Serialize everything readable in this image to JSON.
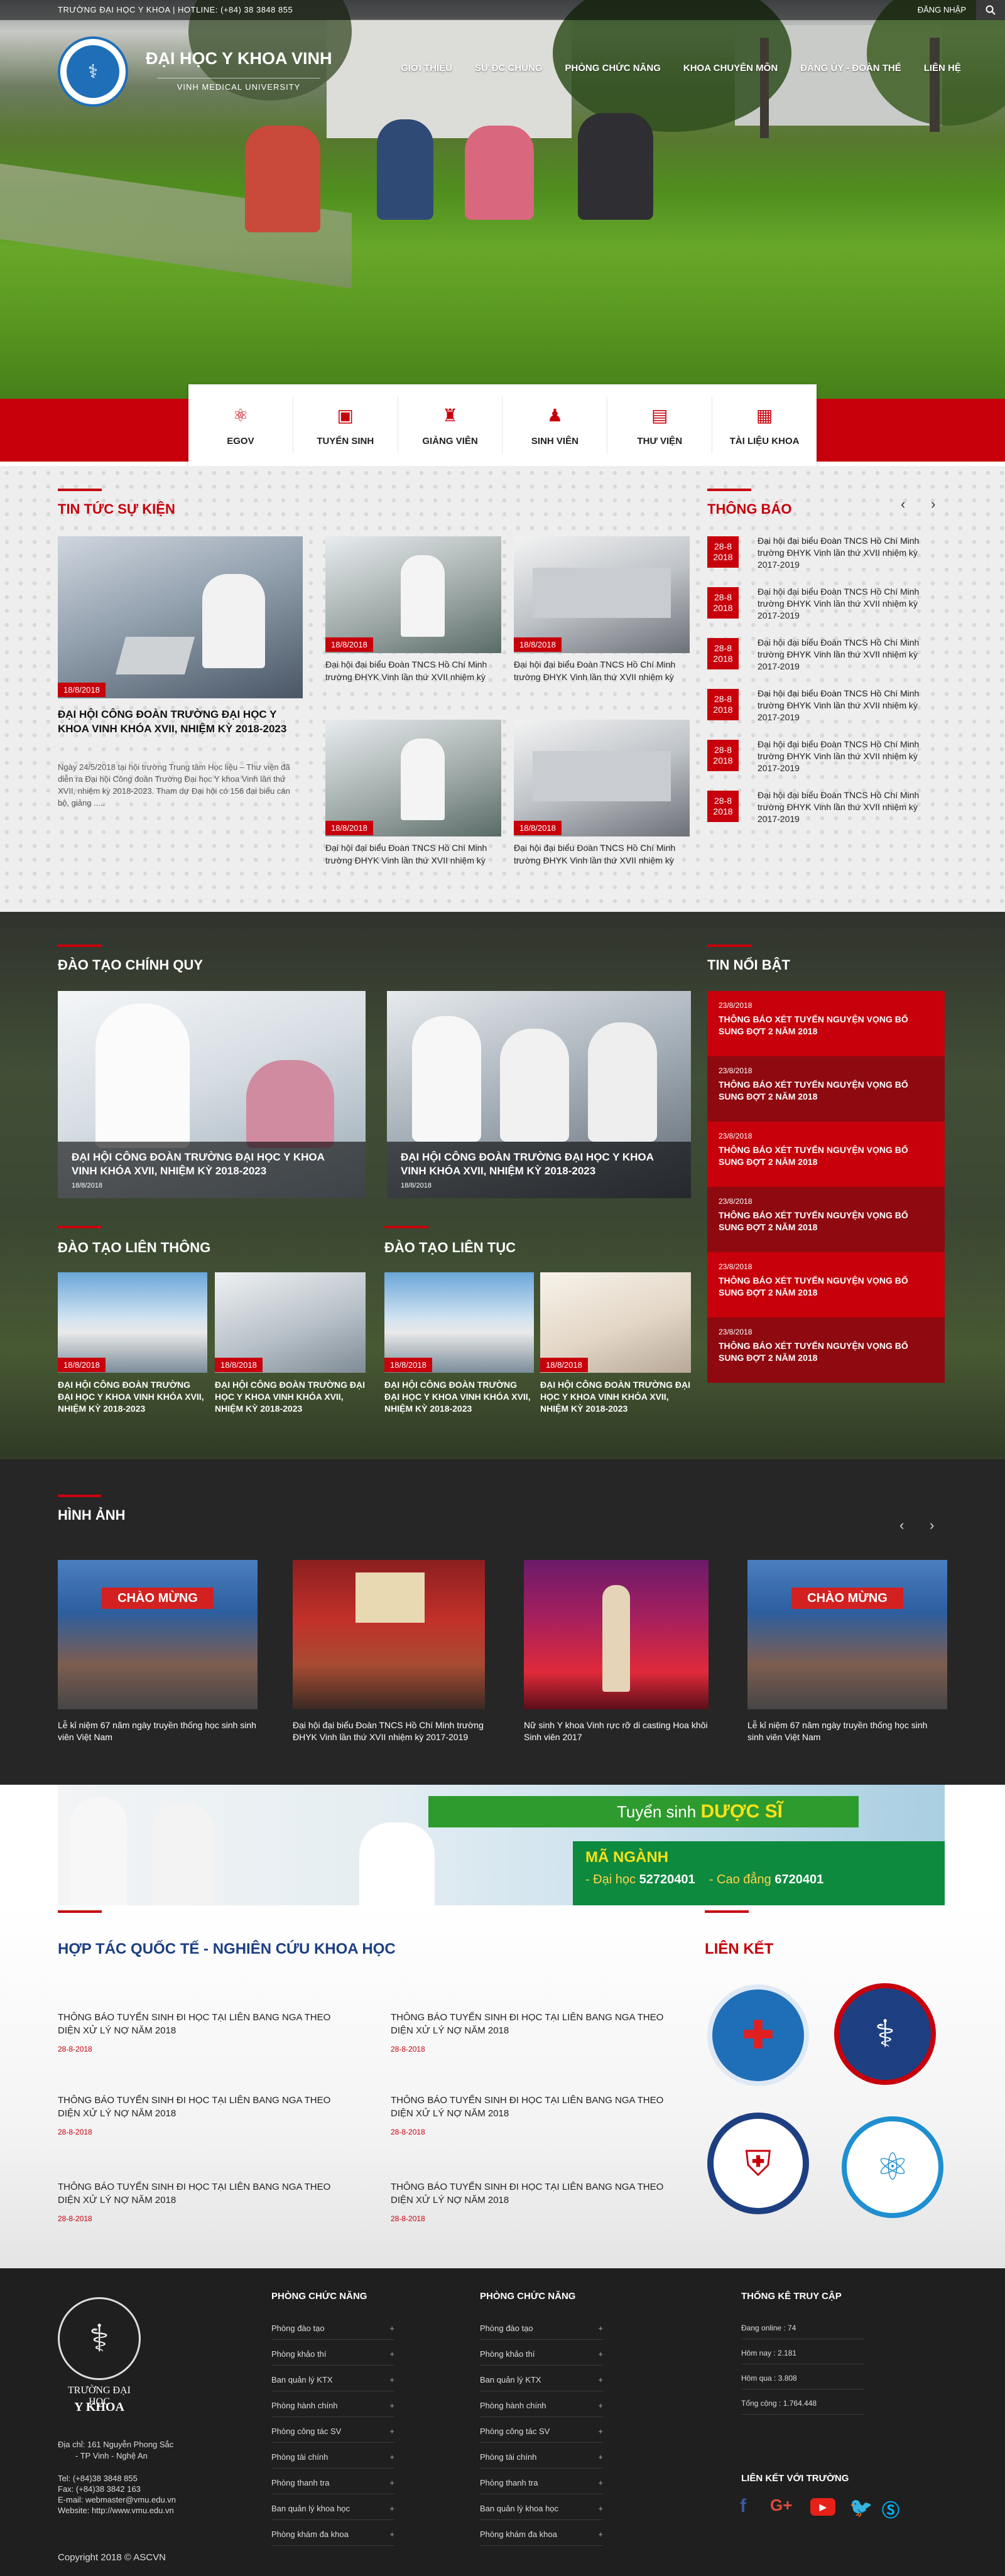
{
  "topbar": {
    "left_text": "TRƯỜNG ĐẠI HỌC Y KHOA  |  HOTLINE: (+84) 38 3848 855",
    "login": "ĐĂNG NHẬP"
  },
  "header": {
    "site_name": "ĐẠI HỌC Y KHOA VINH",
    "site_sub": "VINH MEDICAL UNIVERSITY"
  },
  "nav": [
    "GIỚI THIỆU",
    "SỰ ĐC CHUNG",
    "PHÒNG CHỨC NĂNG",
    "KHOA CHUYÊN MÔN",
    "ĐẢNG ỦY - ĐOÀN THỂ",
    "LIÊN HỆ"
  ],
  "quick_links": [
    {
      "label": "EGOV",
      "icon": "atom-icon"
    },
    {
      "label": "TUYỂN SINH",
      "icon": "enroll-icon"
    },
    {
      "label": "GIẢNG VIÊN",
      "icon": "teacher-icon"
    },
    {
      "label": "SINH VIÊN",
      "icon": "student-icon"
    },
    {
      "label": "THƯ VIỆN",
      "icon": "book-icon"
    },
    {
      "label": "TÀI LIỆU KHOA",
      "icon": "document-icon"
    }
  ],
  "news": {
    "title": "TIN TỨC SỰ KIỆN",
    "featured": {
      "date": "18/8/2018",
      "title": "ĐẠI HỘI CÔNG ĐOÀN TRƯỜNG ĐẠI HỌC Y KHOA VINH KHÓA XVII, NHIỆM KỲ 2018-2023",
      "excerpt": "Ngày 24/5/2018 tại hội trường Trung tâm Học liệu – Thư viện đã diễn ra Đại hội Công đoàn Trường Đại học Y khoa Vinh lần thứ XVII, nhiệm kỳ 2018-2023. Tham dự Đại hội có 156 đại biểu cán bộ, giảng ....."
    },
    "items": [
      {
        "date": "18/8/2018",
        "title": "Đại hội đại biểu Đoàn TNCS Hồ Chí Minh trường ĐHYK Vinh lần thứ XVII nhiệm kỳ"
      },
      {
        "date": "18/8/2018",
        "title": "Đại hội đại biểu Đoàn TNCS Hồ Chí Minh trường ĐHYK Vinh lần thứ XVII nhiệm kỳ"
      },
      {
        "date": "18/8/2018",
        "title": "Đại hội đại biểu Đoàn TNCS Hồ Chí Minh trường ĐHYK Vinh lần thứ XVII nhiệm kỳ"
      },
      {
        "date": "18/8/2018",
        "title": "Đại hội đại biểu Đoàn TNCS Hồ Chí Minh trường ĐHYK Vinh lần thứ XVII nhiệm kỳ"
      }
    ]
  },
  "announcements": {
    "title": "THÔNG BÁO",
    "items": [
      {
        "day": "28-8",
        "year": "2018",
        "text": "Đại hội đại biểu Đoàn TNCS Hồ Chí Minh trường ĐHYK Vinh lần thứ XVII nhiệm kỳ 2017-2019"
      },
      {
        "day": "28-8",
        "year": "2018",
        "text": "Đại hội đại biểu Đoàn TNCS Hồ Chí Minh trường ĐHYK Vinh lần thứ XVII nhiệm kỳ 2017-2019"
      },
      {
        "day": "28-8",
        "year": "2018",
        "text": "Đại hội đại biểu Đoàn TNCS Hồ Chí Minh trường ĐHYK Vinh lần thứ XVII nhiệm kỳ 2017-2019"
      },
      {
        "day": "28-8",
        "year": "2018",
        "text": "Đại hội đại biểu Đoàn TNCS Hồ Chí Minh trường ĐHYK Vinh lần thứ XVII nhiệm kỳ 2017-2019"
      },
      {
        "day": "28-8",
        "year": "2018",
        "text": "Đại hội đại biểu Đoàn TNCS Hồ Chí Minh trường ĐHYK Vinh lần thứ XVII nhiệm kỳ 2017-2019"
      },
      {
        "day": "28-8",
        "year": "2018",
        "text": "Đại hội đại biểu Đoàn TNCS Hồ Chí Minh trường ĐHYK Vinh lần thứ XVII nhiệm kỳ 2017-2019"
      }
    ]
  },
  "regular": {
    "title": "ĐÀO TẠO CHÍNH QUY",
    "items": [
      {
        "title": "ĐẠI HỘI CÔNG ĐOÀN TRƯỜNG ĐẠI HỌC Y KHOA VINH KHÓA XVII, NHIỆM KỲ 2018-2023",
        "date": "18/8/2018"
      },
      {
        "title": "ĐẠI HỘI CÔNG ĐOÀN TRƯỜNG ĐẠI HỌC Y KHOA VINH KHÓA XVII, NHIỆM KỲ 2018-2023",
        "date": "18/8/2018"
      }
    ]
  },
  "highlights": {
    "title": "TIN NỔI BẬT",
    "items": [
      {
        "date": "23/8/2018",
        "title": "THÔNG BÁO XÉT TUYỂN NGUYỆN VỌNG BỔ SUNG  ĐỢT 2 NĂM 2018"
      },
      {
        "date": "23/8/2018",
        "title": "THÔNG BÁO XÉT TUYỂN NGUYỆN VỌNG BỔ SUNG  ĐỢT 2 NĂM 2018"
      },
      {
        "date": "23/8/2018",
        "title": "THÔNG BÁO XÉT TUYỂN NGUYỆN VỌNG BỔ SUNG  ĐỢT 2 NĂM 2018"
      },
      {
        "date": "23/8/2018",
        "title": "THÔNG BÁO XÉT TUYỂN NGUYỆN VỌNG BỔ SUNG  ĐỢT 2 NĂM 2018"
      },
      {
        "date": "23/8/2018",
        "title": "THÔNG BÁO XÉT TUYỂN NGUYỆN VỌNG BỔ SUNG  ĐỢT 2 NĂM 2018"
      },
      {
        "date": "23/8/2018",
        "title": "THÔNG BÁO XÉT TUYỂN NGUYỆN VỌNG BỔ SUNG  ĐỢT 2 NĂM 2018"
      }
    ]
  },
  "transfer": {
    "title": "ĐÀO TẠO LIÊN THÔNG",
    "items": [
      {
        "date": "18/8/2018",
        "title": "ĐẠI HỘI CÔNG ĐOÀN TRƯỜNG ĐẠI HỌC Y KHOA VINH KHÓA XVII, NHIỆM KỲ 2018-2023"
      },
      {
        "date": "18/8/2018",
        "title": "ĐẠI HỘI CÔNG ĐOÀN TRƯỜNG ĐẠI HỌC Y KHOA VINH KHÓA XVII, NHIỆM KỲ 2018-2023"
      }
    ]
  },
  "continuing": {
    "title": "ĐÀO TẠO LIÊN TỤC",
    "items": [
      {
        "date": "18/8/2018",
        "title": "ĐẠI HỘI CÔNG ĐOÀN TRƯỜNG ĐẠI HỌC Y KHOA VINH KHÓA XVII, NHIỆM KỲ 2018-2023"
      },
      {
        "date": "18/8/2018",
        "title": "ĐẠI HỘI CÔNG ĐOÀN TRƯỜNG ĐẠI HỌC Y KHOA VINH KHÓA XVII, NHIỆM KỲ 2018-2023"
      }
    ]
  },
  "gallery": {
    "title": "HÌNH ẢNH",
    "items": [
      {
        "caption": "Lễ kỉ niệm 67 năm ngày truyền thống học sinh sinh viên Việt Nam",
        "banner": "CHÀO MỪNG"
      },
      {
        "caption": "Đại hội đại biểu Đoàn TNCS Hồ Chí Minh trường ĐHYK Vinh lần thứ XVII nhiệm kỳ 2017-2019"
      },
      {
        "caption": "Nữ sinh Y khoa Vinh rực rỡ di casting Hoa khôi Sinh viên 2017"
      },
      {
        "caption": "Lễ kỉ niệm 67 năm ngày truyền thống học sinh sinh viên Việt Nam",
        "banner": "CHÀO MỪNG"
      }
    ]
  },
  "banner": {
    "headline": "Tuyển sinh",
    "headline_em": "DƯỢC SĨ",
    "major_title": "MÃ NGÀNH",
    "uni_label": "- Đại học",
    "uni_code": "52720401",
    "col_label": "- Cao đẳng",
    "col_code": "6720401"
  },
  "cooperation": {
    "title": "HỢP TÁC QUỐC TẾ - NGHIÊN CỨU KHOA HỌC",
    "items": [
      {
        "title": "THÔNG BÁO TUYỂN SINH ĐI HỌC TẠI LIÊN BANG NGA THEO DIỆN XỬ LÝ NỢ NĂM 2018",
        "date": "28-8-2018"
      },
      {
        "title": "THÔNG BÁO TUYỂN SINH ĐI HỌC TẠI LIÊN BANG NGA THEO DIỆN XỬ LÝ NỢ NĂM 2018",
        "date": "28-8-2018"
      },
      {
        "title": "THÔNG BÁO TUYỂN SINH ĐI HỌC TẠI LIÊN BANG NGA THEO DIỆN XỬ LÝ NỢ NĂM 2018",
        "date": "28-8-2018"
      },
      {
        "title": "THÔNG BÁO TUYỂN SINH ĐI HỌC TẠI LIÊN BANG NGA THEO DIỆN XỬ LÝ NỢ NĂM 2018",
        "date": "28-8-2018"
      },
      {
        "title": "THÔNG BÁO TUYỂN SINH ĐI HỌC TẠI LIÊN BANG NGA THEO DIỆN XỬ LÝ NỢ NĂM 2018",
        "date": "28-8-2018"
      },
      {
        "title": "THÔNG BÁO TUYỂN SINH ĐI HỌC TẠI LIÊN BANG NGA THEO DIỆN XỬ LÝ NỢ NĂM 2018",
        "date": "28-8-2018"
      }
    ]
  },
  "links": {
    "title": "LIÊN KẾT"
  },
  "footer": {
    "school_line1": "TRƯỜNG ĐẠI HỌC",
    "school_line2": "Y KHOA",
    "address1": "Địa chỉ: 161 Nguyễn Phong Sắc",
    "address2": "- TP Vinh - Nghệ An",
    "tel": "Tel: (+84)38 3848 855",
    "fax": "Fax: (+84)38 3842 163",
    "email": "E-mail: webmaster@vmu.edu.vn",
    "website": "Website: http://www.vmu.edu.vn",
    "col1_title": "PHÒNG CHỨC NĂNG",
    "col2_title": "PHÒNG CHỨC NĂNG",
    "departments": [
      "Phòng đào tạo",
      "Phòng khảo thí",
      "Ban quản lý KTX",
      "Phòng hành chính",
      "Phòng công tác SV",
      "Phòng tài chính",
      "Phòng thanh tra",
      "Ban quản lý khoa học",
      "Phòng khám đa khoa"
    ],
    "stats_title": "THỐNG KÊ TRUY CẬP",
    "stats": [
      "Đang online : 74",
      "Hôm nay : 2.181",
      "Hôm qua : 3.808",
      "Tổng cộng : 1.764.448"
    ],
    "social_title": "LIÊN KẾT VỚI TRƯỜNG",
    "copyright": "Copyright  2018 © ASCVN"
  }
}
